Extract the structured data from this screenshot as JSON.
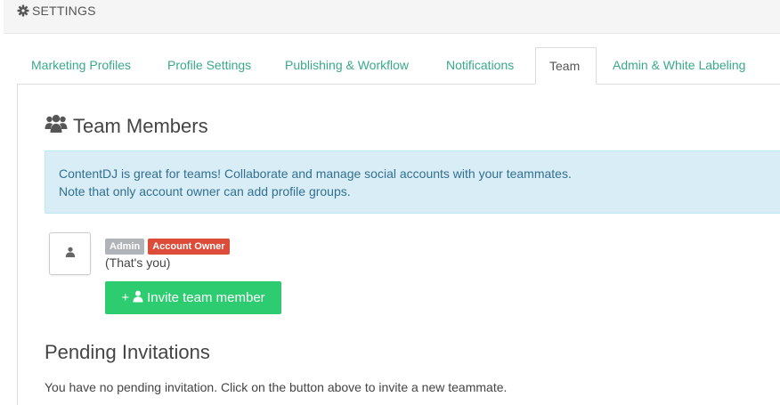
{
  "header": {
    "title": "SETTINGS",
    "icon": "gear-icon"
  },
  "tabs": [
    {
      "label": "Marketing Profiles",
      "active": false
    },
    {
      "label": "Profile Settings",
      "active": false
    },
    {
      "label": "Publishing & Workflow",
      "active": false
    },
    {
      "label": "Notifications",
      "active": false
    },
    {
      "label": "Team",
      "active": true
    },
    {
      "label": "Admin & White Labeling",
      "active": false
    }
  ],
  "team": {
    "heading": "Team Members",
    "heading_icon": "users-icon",
    "info_line1": "ContentDJ is great for teams! Collaborate and manage social accounts with your teammates.",
    "info_line2": "Note that only account owner can add profile groups.",
    "member": {
      "avatar_icon": "user-icon",
      "badge_admin": "Admin",
      "badge_owner": "Account Owner",
      "note": "(That's you)"
    },
    "invite_button": {
      "prefix": "+",
      "icon": "user-icon",
      "label": "Invite team member"
    }
  },
  "pending": {
    "heading": "Pending Invitations",
    "empty_text": "You have no pending invitation. Click on the button above to invite a new teammate."
  },
  "colors": {
    "tab_link": "#3aa98a",
    "info_bg": "#d9edf7",
    "info_text": "#31708f",
    "badge_admin": "#b0b3b8",
    "badge_owner": "#dd4b39",
    "invite_button": "#2ecc71"
  }
}
